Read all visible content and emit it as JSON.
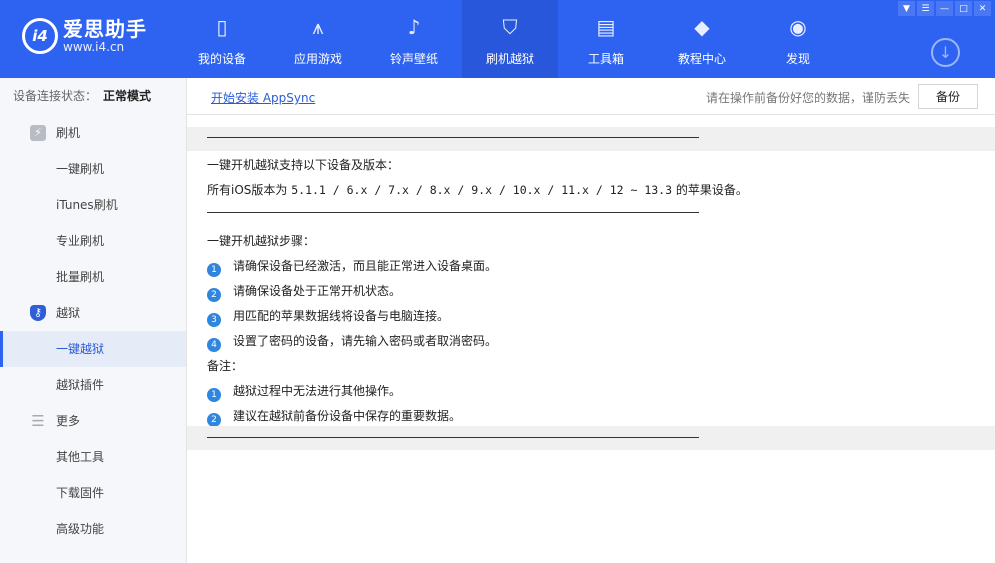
{
  "app": {
    "name": "爱思助手",
    "url": "www.i4.cn",
    "logo_mark": "i4"
  },
  "nav": [
    {
      "label": "我的设备",
      "icon": "phone-icon"
    },
    {
      "label": "应用游戏",
      "icon": "app-store-icon"
    },
    {
      "label": "铃声壁纸",
      "icon": "music-icon"
    },
    {
      "label": "刷机越狱",
      "icon": "shield-key-icon"
    },
    {
      "label": "工具箱",
      "icon": "toolbox-icon"
    },
    {
      "label": "教程中心",
      "icon": "graduation-cap-icon"
    },
    {
      "label": "发现",
      "icon": "compass-icon"
    }
  ],
  "subbar": {
    "status_label": "设备连接状态：",
    "status_value": "正常模式",
    "appsync_link": "开始安装 AppSync",
    "warning": "请在操作前备份好您的数据，谨防丢失",
    "backup_button": "备份"
  },
  "sidebar": [
    {
      "label": "刷机",
      "group": true
    },
    {
      "label": "一键刷机"
    },
    {
      "label": "iTunes刷机"
    },
    {
      "label": "专业刷机"
    },
    {
      "label": "批量刷机"
    },
    {
      "label": "越狱",
      "group": true
    },
    {
      "label": "一键越狱",
      "active": true
    },
    {
      "label": "越狱插件"
    },
    {
      "label": "更多",
      "group": true
    },
    {
      "label": "其他工具"
    },
    {
      "label": "下载固件"
    },
    {
      "label": "高级功能"
    }
  ],
  "content": {
    "support_title": "一键开机越狱支持以下设备及版本：",
    "support_prefix": "所有iOS版本为",
    "support_versions": "5.1.1 / 6.x / 7.x / 8.x / 9.x / 10.x / 11.x / 12 ~ 13.3",
    "support_suffix": "的苹果设备。",
    "steps_title": "一键开机越狱步骤：",
    "steps": [
      "请确保设备已经激活，而且能正常进入设备桌面。",
      "请确保设备处于正常开机状态。",
      "用匹配的苹果数据线将设备与电脑连接。",
      "设置了密码的设备，请先输入密码或者取消密码。"
    ],
    "notes_title": "备注：",
    "notes": [
      "越狱过程中无法进行其他操作。",
      "建议在越狱前备份设备中保存的重要数据。"
    ]
  }
}
